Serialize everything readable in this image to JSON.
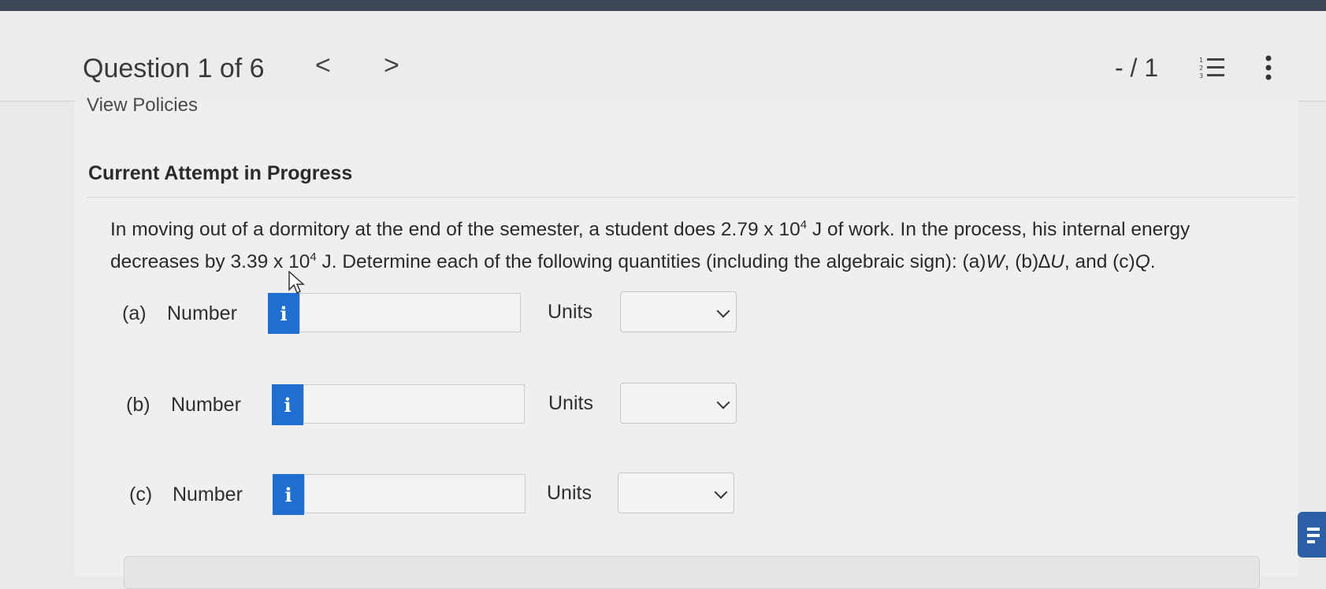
{
  "header": {
    "question_label": "Question 1 of 6",
    "prev_glyph": "<",
    "next_glyph": ">",
    "score": "- / 1"
  },
  "content": {
    "view_policies": "View Policies",
    "attempt_heading": "Current Attempt in Progress",
    "question": {
      "s1": "In moving out of a dormitory at the end of the semester, a student does 2.79 x 10",
      "e1": "4",
      "s2": " J of work. In the process, his internal energy decreases by 3.39 x 10",
      "e2": "4",
      "s3": " J. Determine each of the following quantities (including the algebraic sign): (a)",
      "v1": "W",
      "s4": ", (b)",
      "v2": "∆U",
      "s5": ", and (c)",
      "v3": "Q",
      "s6": "."
    }
  },
  "parts": [
    {
      "label": "(a)",
      "number_label": "Number",
      "info": "i",
      "value": "",
      "units_label": "Units",
      "units_value": ""
    },
    {
      "label": "(b)",
      "number_label": "Number",
      "info": "i",
      "value": "",
      "units_label": "Units",
      "units_value": ""
    },
    {
      "label": "(c)",
      "number_label": "Number",
      "info": "i",
      "value": "",
      "units_label": "Units",
      "units_value": ""
    }
  ],
  "colors": {
    "info_button": "#1e6fd0",
    "top_bar": "#3c4757",
    "chat_button": "#2d5fa6"
  }
}
